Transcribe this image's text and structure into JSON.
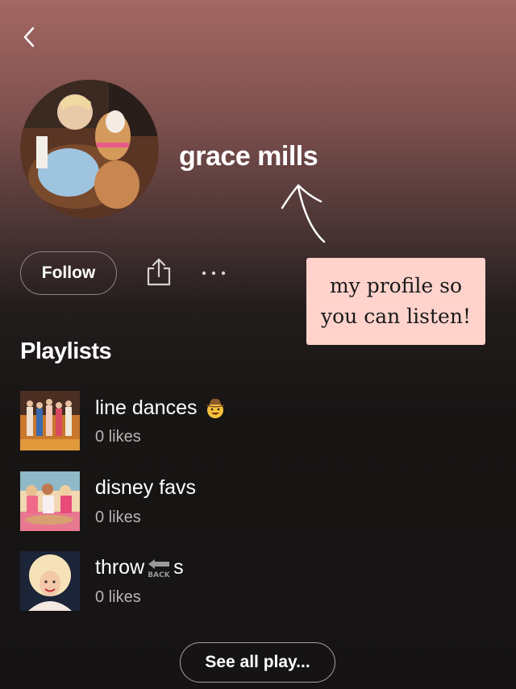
{
  "profile": {
    "name": "grace mills",
    "follow_label": "Follow",
    "more_label": "···"
  },
  "annotation": {
    "line1": "my profile so",
    "line2": "you can listen!"
  },
  "playlists_section": {
    "title": "Playlists",
    "items": [
      {
        "title": "line dances",
        "title_suffix": "",
        "emoji": "cowboy-face-emoji",
        "likes": "0 likes"
      },
      {
        "title": "disney favs",
        "title_suffix": "",
        "emoji": "",
        "likes": "0 likes"
      },
      {
        "title": "throw",
        "title_suffix": "s",
        "emoji": "back-arrow-emoji",
        "likes": "0 likes"
      }
    ],
    "see_all_label": "See all play..."
  },
  "icons": {
    "back": "chevron-left-icon",
    "share": "share-icon",
    "more": "more-dots-icon"
  },
  "colors": {
    "header_top": "#a46762",
    "background": "#151313",
    "note_background": "#ffd3cc",
    "secondary_text": "#b9b3b3"
  }
}
